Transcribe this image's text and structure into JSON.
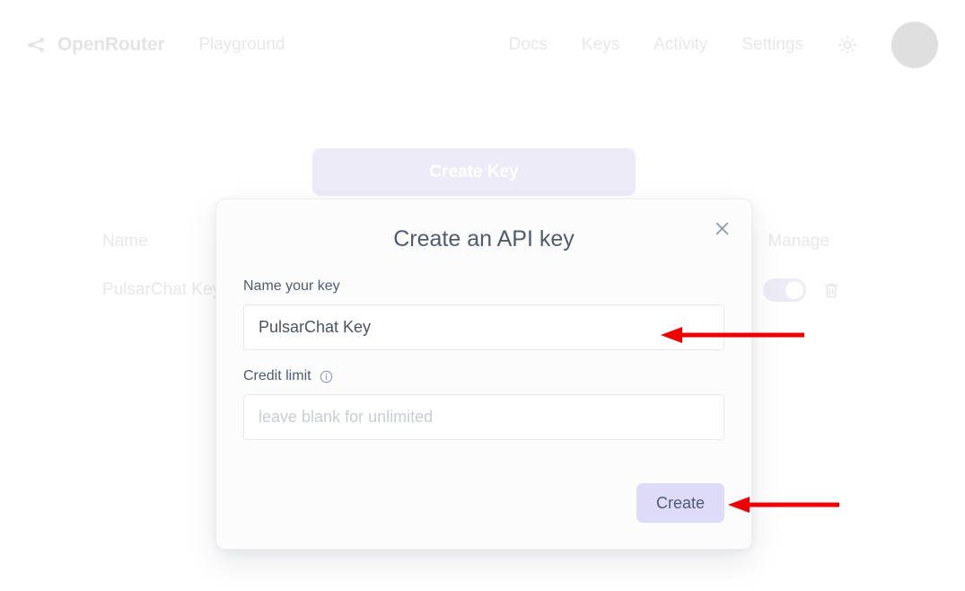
{
  "header": {
    "logo_icon": "share-icon",
    "brand": "OpenRouter",
    "playground_label": "Playground",
    "nav": [
      {
        "label": "Docs"
      },
      {
        "label": "Keys"
      },
      {
        "label": "Activity"
      },
      {
        "label": "Settings"
      }
    ],
    "theme_icon": "sun-icon",
    "avatar": {
      "name": "avatar",
      "color": "#000000"
    }
  },
  "page": {
    "create_key_button": "Create Key",
    "table": {
      "columns": [
        "Name",
        "Manage"
      ],
      "rows": [
        {
          "name": "PulsarChat Key",
          "enabled": true,
          "delete_icon": "trash-icon"
        }
      ]
    }
  },
  "modal": {
    "title": "Create an API key",
    "close_icon": "close-icon",
    "name_field": {
      "label": "Name your key",
      "value": "PulsarChat Key",
      "placeholder": ""
    },
    "credit_field": {
      "label": "Credit limit",
      "info_icon": "info-icon",
      "value": "",
      "placeholder": "leave blank for unlimited"
    },
    "submit_label": "Create"
  },
  "colors": {
    "accent": "#6d5ef0",
    "accent_soft": "#dedbf8",
    "text": "#4f5b6e",
    "placeholder": "#c8ccd6",
    "annotation": "#ef0000"
  },
  "annotations": [
    {
      "name": "arrow-to-name-input",
      "color": "#ef0000"
    },
    {
      "name": "arrow-to-create-button",
      "color": "#ef0000"
    }
  ]
}
